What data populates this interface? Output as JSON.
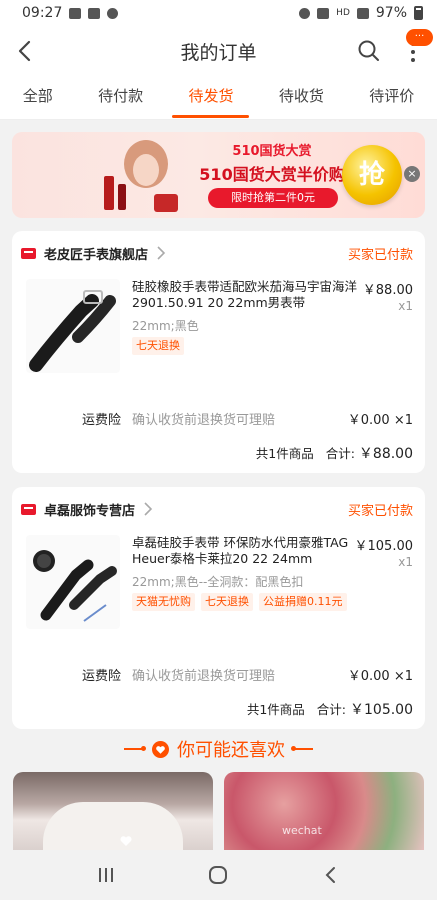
{
  "status_bar": {
    "time": "09:27",
    "battery": "97%",
    "network": "HD"
  },
  "nav": {
    "title": "我的订单",
    "badge": "···"
  },
  "tabs": [
    {
      "label": "全部"
    },
    {
      "label": "待付款"
    },
    {
      "label": "待发货",
      "active": true
    },
    {
      "label": "待收货"
    },
    {
      "label": "待评价"
    }
  ],
  "banner": {
    "line1": "510国货大赏",
    "line2": "510国货大赏半价购",
    "button": "限时抢第二件0元",
    "grab": "抢"
  },
  "orders": [
    {
      "shop": "老皮匠手表旗舰店",
      "status": "买家已付款",
      "item": {
        "title": "硅胶橡胶手表带适配欧米茄海马宇宙海洋2901.50.91 20 22mm男表带",
        "price": "￥88.00",
        "qty": "x1",
        "spec": "22mm;黑色",
        "tags": [
          "七天退换"
        ]
      },
      "shipping": {
        "label": "运费险",
        "desc": "确认收货前退换货可理赔",
        "value": "￥0.00 ×1"
      },
      "total": {
        "count": "共1件商品",
        "label": "合计:",
        "amount": "￥88.00"
      }
    },
    {
      "shop": "卓磊服饰专营店",
      "status": "买家已付款",
      "item": {
        "title": "卓磊硅胶手表带 环保防水代用豪雅TAG Heuer泰格卡莱拉20 22 24mm",
        "price": "￥105.00",
        "qty": "x1",
        "spec": "22mm;黑色--全洞款：配黑色扣",
        "tags": [
          "天猫无忧购",
          "七天退换",
          "公益捐赠0.11元"
        ]
      },
      "shipping": {
        "label": "运费险",
        "desc": "确认收货前退换货可理赔",
        "value": "￥0.00 ×1"
      },
      "total": {
        "count": "共1件商品",
        "label": "合计:",
        "amount": "￥105.00"
      }
    }
  ],
  "recommend": {
    "title": "你可能还喜欢",
    "watermark": "wechat"
  },
  "colors": {
    "accent": "#ff5000",
    "tmall": "#e8192c",
    "background": "#f2f2f2"
  }
}
